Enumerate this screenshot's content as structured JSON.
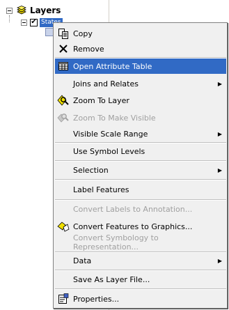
{
  "toc": {
    "root_label": "Layers",
    "layer_label": "States"
  },
  "menu": {
    "items": [
      {
        "label": "Copy",
        "icon": "copy-icon"
      },
      {
        "label": "Remove",
        "icon": "remove-icon"
      },
      {
        "label": "Open Attribute Table",
        "icon": "table-icon",
        "highlighted": true
      },
      {
        "label": "Joins and Relates",
        "submenu": true
      },
      {
        "label": "Zoom To Layer",
        "icon": "zoom-to-layer-icon"
      },
      {
        "label": "Zoom To Make Visible",
        "icon": "zoom-visible-icon",
        "disabled": true
      },
      {
        "label": "Visible Scale Range",
        "submenu": true
      },
      {
        "label": "Use Symbol Levels"
      },
      {
        "label": "Selection",
        "submenu": true
      },
      {
        "label": "Label Features"
      },
      {
        "label": "Convert Labels to Annotation...",
        "disabled": true
      },
      {
        "label": "Convert Features to Graphics...",
        "icon": "convert-graphics-icon"
      },
      {
        "label": "Convert Symbology to Representation...",
        "disabled": true
      },
      {
        "label": "Data",
        "submenu": true
      },
      {
        "label": "Save As Layer File..."
      },
      {
        "label": "Properties...",
        "icon": "properties-icon"
      }
    ],
    "highlight_color": "#316ac5",
    "submenu_glyph": "▶"
  }
}
